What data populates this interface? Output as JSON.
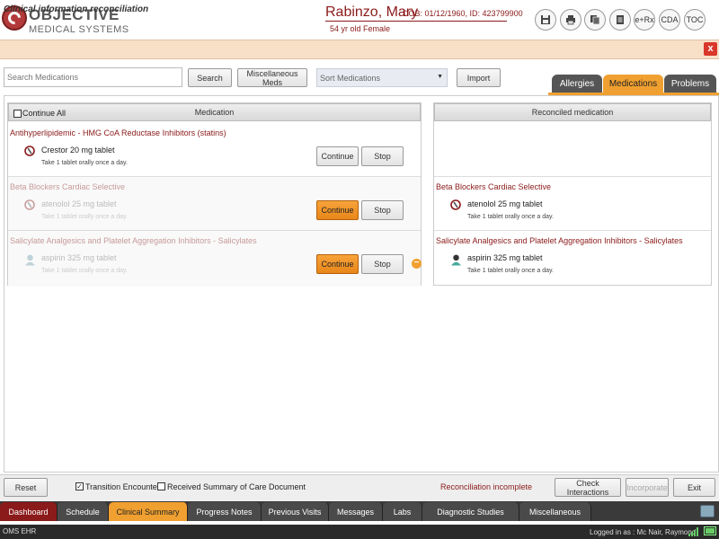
{
  "header": {
    "logo_line1": "OBJECTIVE",
    "logo_line2": "MEDICAL SYSTEMS",
    "patient_name": "Rabinzo, Mary",
    "patient_dob": "DOB: 01/12/1960, ID: 423799900",
    "patient_age": "54 yr old  Female",
    "buttons": [
      {
        "label": "",
        "icon": "save-icon"
      },
      {
        "label": "",
        "icon": "print-icon"
      },
      {
        "label": "",
        "icon": "copy-icon"
      },
      {
        "label": "",
        "icon": "document-icon"
      },
      {
        "label": "e+Rx",
        "icon": "erx-icon"
      },
      {
        "label": "CDA",
        "icon": "cda-icon"
      },
      {
        "label": "TOC",
        "icon": "toc-icon"
      }
    ]
  },
  "titlebar": {
    "title": "Clinical information reconciliation",
    "close": "x"
  },
  "toolbar": {
    "search_placeholder": "Search Medications",
    "search_btn": "Search",
    "misc_btn": "Miscellaneous Meds",
    "sort_value": "Sort Medications",
    "import_btn": "Import"
  },
  "tabs": [
    {
      "label": "Allergies",
      "active": false
    },
    {
      "label": "Medications",
      "active": true
    },
    {
      "label": "Problems",
      "active": false
    }
  ],
  "left": {
    "continue_all": "Continue All",
    "header": "Medication",
    "groups": [
      {
        "title": "Antihyperlipidemic - HMG CoA Reductase Inhibitors (statins)",
        "med": "Crestor 20 mg tablet",
        "sig": "Take 1 tablet orally once a day.",
        "faded": false,
        "continue_active": false,
        "continue": "Continue",
        "stop": "Stop",
        "icon": "rx-icon"
      },
      {
        "title": "Beta Blockers Cardiac Selective",
        "med": "atenolol 25 mg tablet",
        "sig": "Take 1 tablet orally once a day.",
        "faded": true,
        "continue_active": true,
        "continue": "Continue",
        "stop": "Stop",
        "icon": "rx-icon"
      },
      {
        "title": "Salicylate Analgesics and Platelet Aggregation Inhibitors - Salicylates",
        "med": "aspirin 325 mg tablet",
        "sig": "Take 1 tablet orally once a day.",
        "faded": true,
        "continue_active": true,
        "continue": "Continue",
        "stop": "Stop",
        "icon": "patient-icon",
        "minus": "−"
      }
    ]
  },
  "right": {
    "header": "Reconciled medication",
    "groups": [
      {
        "title": "",
        "med": "",
        "sig": ""
      },
      {
        "title": "Beta Blockers Cardiac Selective",
        "med": "atenolol 25 mg tablet",
        "sig": "Take 1 tablet orally once a day.",
        "icon": "rx-icon"
      },
      {
        "title": "Salicylate Analgesics and Platelet Aggregation Inhibitors - Salicylates",
        "med": "aspirin 325 mg tablet",
        "sig": "Take 1 tablet orally once a day.",
        "icon": "patient-icon"
      }
    ]
  },
  "actions": {
    "reset": "Reset",
    "transition_encounter": "Transition Encounter",
    "transition_checked": true,
    "received_summary": "Received Summary of Care Document",
    "received_checked": false,
    "status": "Reconciliation incomplete",
    "check_interactions": "Check Interactions",
    "incorporate": "Incorporate",
    "exit": "Exit"
  },
  "nav": [
    "Dashboard",
    "Schedule",
    "Clinical Summary",
    "Progress Notes",
    "Previous Visits",
    "Messages",
    "Labs",
    "Diagnostic Studies",
    "Miscellaneous"
  ],
  "nav_active": "Clinical Summary",
  "status": {
    "left": "OMS EHR",
    "right": "Logged in as : Mc Nair, Raymond"
  },
  "colors": {
    "accent": "#f0a030",
    "brand": "#8b1a1a",
    "close": "#d9372a"
  }
}
